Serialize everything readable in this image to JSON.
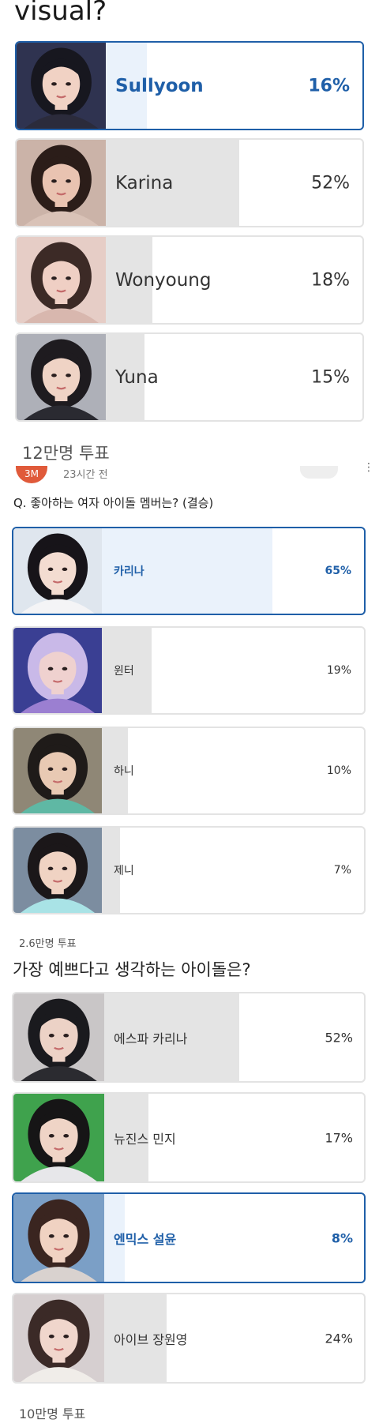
{
  "poll1": {
    "title_fragment": "visual?",
    "options": [
      {
        "name": "Sullyoon",
        "percent": "16%",
        "share": 0.16,
        "selected": true,
        "bg": "#2f3350",
        "skin": "#f1d2c4",
        "hair": "#17171f",
        "cloth": "#2b2b3b"
      },
      {
        "name": "Karina",
        "percent": "52%",
        "share": 0.52,
        "selected": false,
        "bg": "#cbb3a8",
        "skin": "#e9c3b1",
        "hair": "#2b1d19",
        "cloth": "#d9c2b7"
      },
      {
        "name": "Wonyoung",
        "percent": "18%",
        "share": 0.18,
        "selected": false,
        "bg": "#e6cdc6",
        "skin": "#efcfc4",
        "hair": "#3c2a26",
        "cloth": "#d8b7ae"
      },
      {
        "name": "Yuna",
        "percent": "15%",
        "share": 0.15,
        "selected": false,
        "bg": "#aeb0b8",
        "skin": "#efd3c5",
        "hair": "#1e1b1f",
        "cloth": "#2a2a31"
      }
    ],
    "votes": "12만명 투표"
  },
  "poll2": {
    "avatar_text": "3M",
    "time": "23시간 전",
    "question": "Q. 좋아하는 여자 아이돌 멤버는? (결승)",
    "options": [
      {
        "name": "카리나",
        "percent": "65%",
        "share": 0.65,
        "selected": true,
        "bg": "#dfe6ee",
        "skin": "#f3dcd1",
        "hair": "#171419",
        "cloth": "#f4f4f6"
      },
      {
        "name": "윈터",
        "percent": "19%",
        "share": 0.19,
        "selected": false,
        "bg": "#3a3f93",
        "skin": "#efd1cf",
        "hair": "#c9b9e8",
        "cloth": "#9b7fd1"
      },
      {
        "name": "하니",
        "percent": "10%",
        "share": 0.1,
        "selected": false,
        "bg": "#8f8776",
        "skin": "#e8c9b3",
        "hair": "#1f1b19",
        "cloth": "#5fb8a4"
      },
      {
        "name": "제니",
        "percent": "7%",
        "share": 0.07,
        "selected": false,
        "bg": "#7c8da0",
        "skin": "#f0d3c3",
        "hair": "#1b1719",
        "cloth": "#a9e3e6"
      }
    ],
    "votes": "2.6만명 투표"
  },
  "poll3": {
    "question": "가장 예쁘다고 생각하는 아이돌은?",
    "options": [
      {
        "name": "에스파 카리나",
        "percent": "52%",
        "share": 0.52,
        "selected": false,
        "bg": "#c9c6c7",
        "skin": "#ecd2c6",
        "hair": "#1a1a1e",
        "cloth": "#2b2b30"
      },
      {
        "name": "뉴진스 민지",
        "percent": "17%",
        "share": 0.17,
        "selected": false,
        "bg": "#3fa24d",
        "skin": "#efd4c6",
        "hair": "#161516",
        "cloth": "#e7e7ea"
      },
      {
        "name": "엔믹스 설윤",
        "percent": "8%",
        "share": 0.08,
        "selected": true,
        "bg": "#7b9fc6",
        "skin": "#f0d2c2",
        "hair": "#3a2520",
        "cloth": "#d9d2cf"
      },
      {
        "name": "아이브 장원영",
        "percent": "24%",
        "share": 0.24,
        "selected": false,
        "bg": "#d6cfd0",
        "skin": "#f0d6cc",
        "hair": "#3b2a27",
        "cloth": "#f0ede9"
      }
    ],
    "votes": "10만명 투표"
  }
}
